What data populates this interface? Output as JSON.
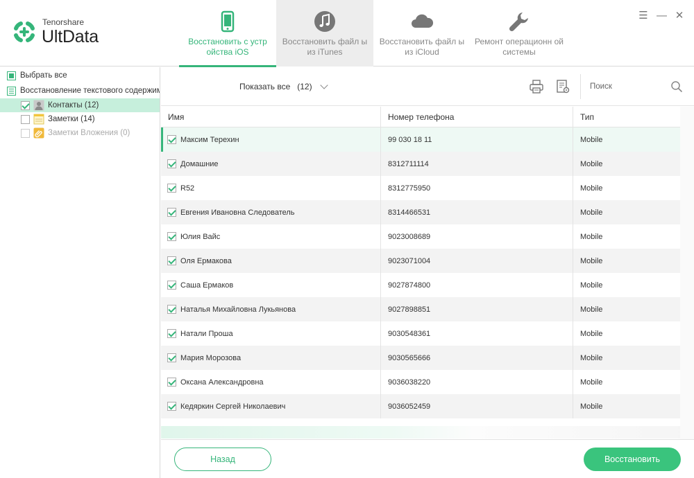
{
  "brand": {
    "vendor": "Tenorshare",
    "product": "UltData",
    "accent": "#35b57a"
  },
  "window_controls": [
    {
      "icon": "menu-icon",
      "glyph": "☰"
    },
    {
      "icon": "minimize-icon",
      "glyph": "—"
    },
    {
      "icon": "close-icon",
      "glyph": "✕"
    }
  ],
  "tabs": [
    {
      "label": "Восстановить с устр ойства iOS",
      "icon": "phone-icon",
      "active": true
    },
    {
      "label": "Восстановить файл ы из iTunes",
      "icon": "music-note-icon",
      "active": false
    },
    {
      "label": "Восстановить файл ы из iCloud",
      "icon": "cloud-icon",
      "active": false
    },
    {
      "label": "Ремонт операционн ой системы",
      "icon": "wrench-icon",
      "active": false
    }
  ],
  "sidebar": {
    "select_all": "Выбрать все",
    "category": "Восстановление текстового содержимого",
    "items": [
      {
        "label": "Контакты (12)",
        "icon": "contacts-icon",
        "checked": true,
        "selected": true
      },
      {
        "label": "Заметки (14)",
        "icon": "notes-icon",
        "checked": false,
        "selected": false
      },
      {
        "label": "Заметки Вложения (0)",
        "icon": "attachment-icon",
        "checked": false,
        "disabled": true
      }
    ]
  },
  "toolbar": {
    "show_label": "Показать все",
    "show_count": "(12)",
    "search_placeholder": "Поиск"
  },
  "table": {
    "columns": [
      "Имя",
      "Номер телефона",
      "Тип"
    ],
    "rows": [
      {
        "name": "Максим Терехин",
        "phone": " 99 030 18 11",
        "type": "Mobile"
      },
      {
        "name": "Домашние",
        "phone": "8312711114",
        "type": "Mobile"
      },
      {
        "name": "R52",
        "phone": "8312775950",
        "type": "Mobile"
      },
      {
        "name": "Евгения Ивановна Следователь",
        "phone": "8314466531",
        "type": "Mobile"
      },
      {
        "name": "Юлия Вайс",
        "phone": "9023008689",
        "type": "Mobile"
      },
      {
        "name": "Оля Ермакова",
        "phone": "9023071004",
        "type": "Mobile"
      },
      {
        "name": "Саша Ермаков",
        "phone": "9027874800",
        "type": "Mobile"
      },
      {
        "name": "Наталья Михайловна Лукьянова",
        "phone": "9027898851",
        "type": "Mobile"
      },
      {
        "name": "Натали Проша",
        "phone": "9030548361",
        "type": "Mobile"
      },
      {
        "name": "Мария Морозова",
        "phone": "9030565666",
        "type": "Mobile"
      },
      {
        "name": "Оксана Александровна",
        "phone": "9036038220",
        "type": "Mobile"
      },
      {
        "name": "Кедяркин Сергей Николаевич",
        "phone": "9036052459",
        "type": "Mobile"
      }
    ]
  },
  "footer": {
    "back_label": "Назад",
    "restore_label": "Восстановить"
  }
}
